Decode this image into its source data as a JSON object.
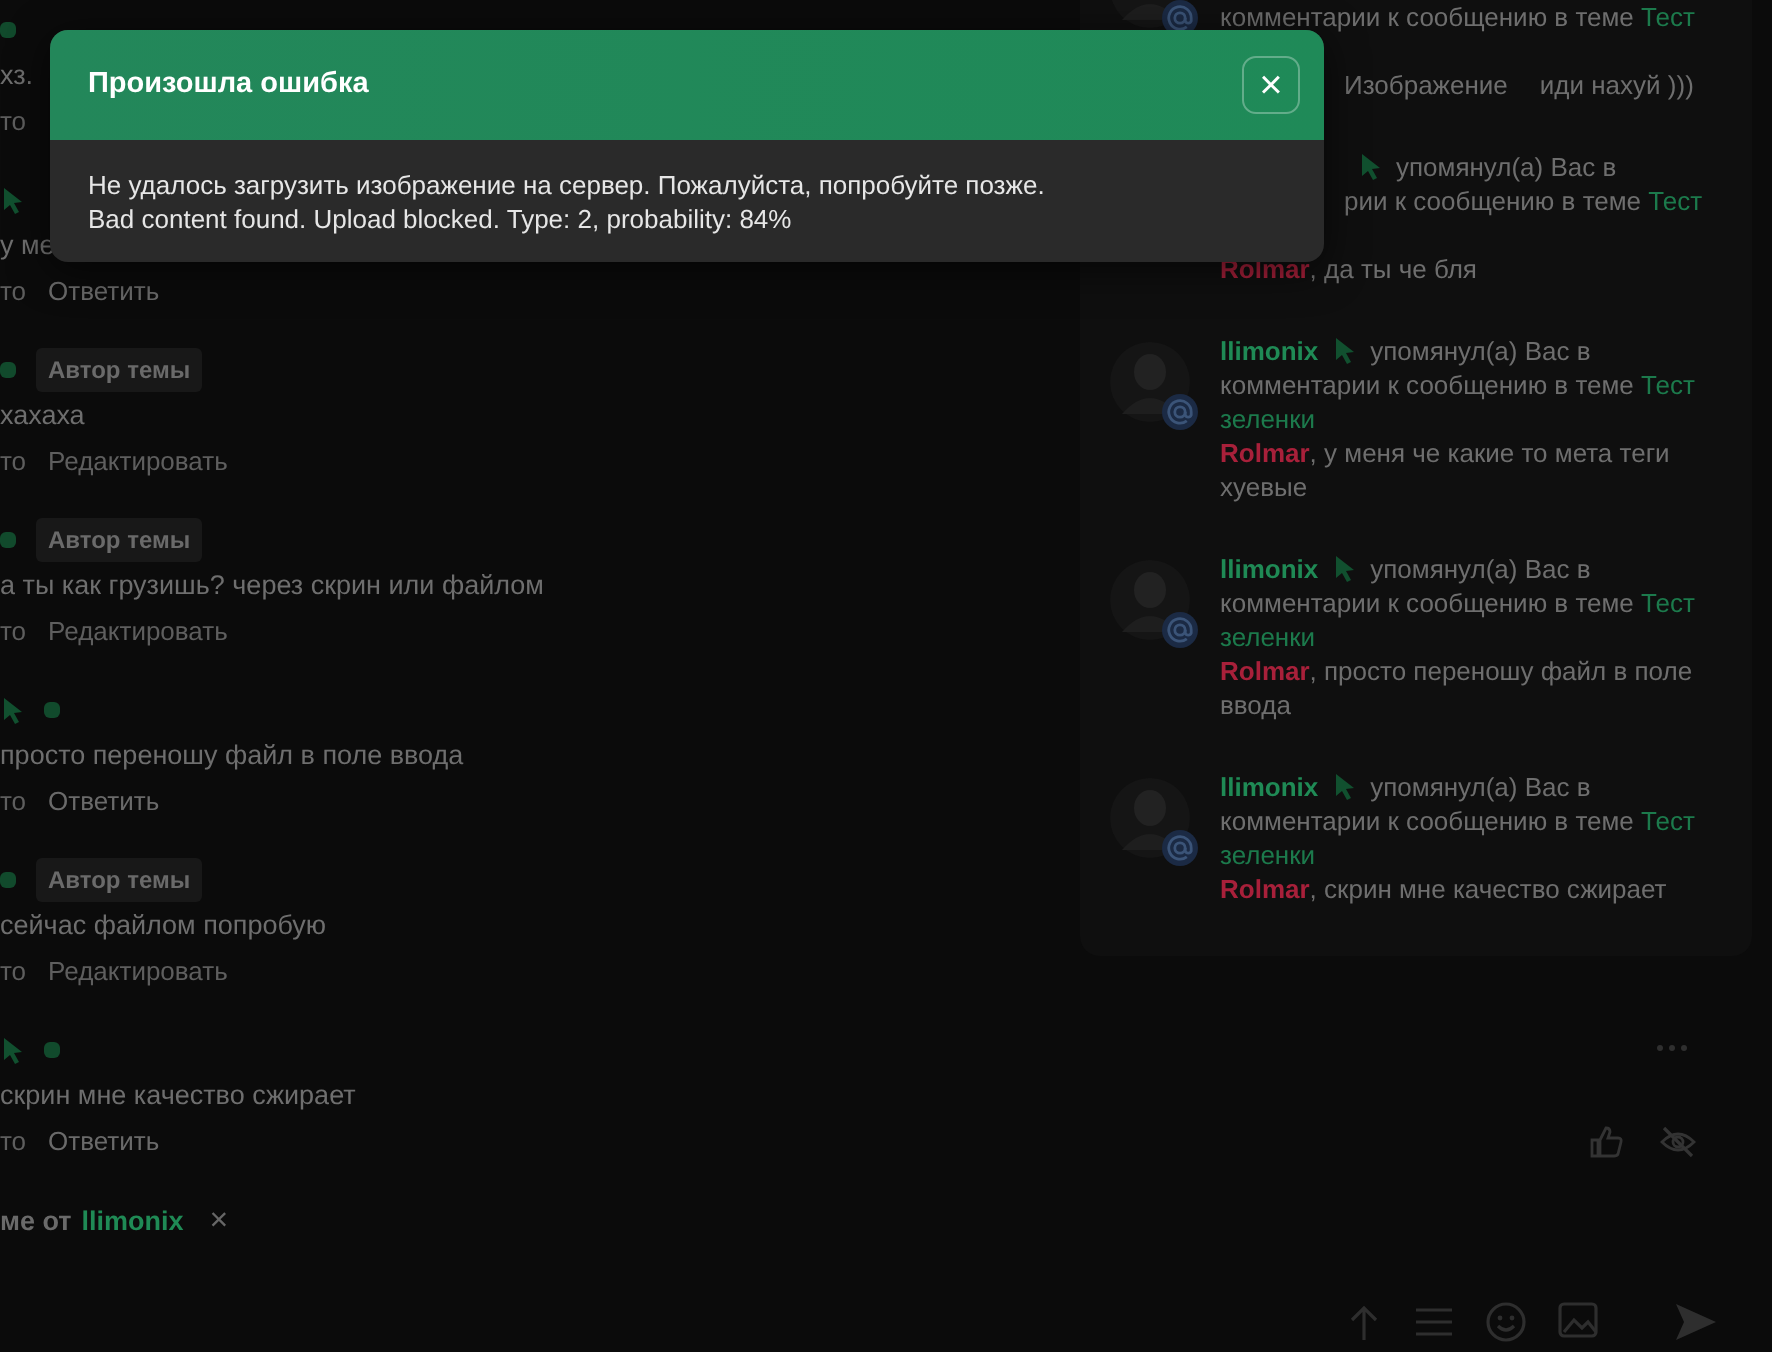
{
  "messages": [
    {
      "header": [
        {
          "kind": "dot"
        }
      ],
      "text": "хз.",
      "actions": [
        {
          "kind": "meta",
          "text": "то"
        }
      ]
    },
    {
      "header": [
        {
          "kind": "cursor"
        }
      ],
      "text": "у ме",
      "actions": [
        {
          "kind": "meta",
          "text": "то"
        },
        {
          "kind": "reply",
          "text": "Ответить"
        }
      ]
    },
    {
      "header": [
        {
          "kind": "dot"
        },
        {
          "kind": "badge",
          "text": "Автор темы"
        }
      ],
      "text": "хахаха",
      "actions": [
        {
          "kind": "meta",
          "text": "то"
        },
        {
          "kind": "edit",
          "text": "Редактировать"
        }
      ]
    },
    {
      "header": [
        {
          "kind": "dot"
        },
        {
          "kind": "badge",
          "text": "Автор темы"
        }
      ],
      "text": "а ты как грузишь? через скрин или файлом",
      "actions": [
        {
          "kind": "meta",
          "text": "то"
        },
        {
          "kind": "edit",
          "text": "Редактировать"
        }
      ]
    },
    {
      "header": [
        {
          "kind": "cursor"
        },
        {
          "kind": "dot"
        }
      ],
      "text": "просто переношу файл в поле ввода",
      "actions": [
        {
          "kind": "meta",
          "text": "то"
        },
        {
          "kind": "reply",
          "text": "Ответить"
        }
      ]
    },
    {
      "header": [
        {
          "kind": "dot"
        },
        {
          "kind": "badge",
          "text": "Автор темы"
        }
      ],
      "text": "сейчас файлом попробую",
      "actions": [
        {
          "kind": "meta",
          "text": "то"
        },
        {
          "kind": "edit",
          "text": "Редактировать"
        }
      ]
    },
    {
      "header": [
        {
          "kind": "cursor"
        },
        {
          "kind": "dot"
        }
      ],
      "text": "скрин мне качество сжирает",
      "actions": [
        {
          "kind": "meta",
          "text": "то"
        },
        {
          "kind": "reply",
          "text": "Ответить"
        }
      ]
    }
  ],
  "reply_bar": {
    "prefix": "ме от",
    "user": "llimonix",
    "close": "×"
  },
  "notifications": [
    {
      "avatar": true,
      "cut_top": true,
      "lines": [
        {
          "kind": "full",
          "segments": [
            {
              "kind": "plain",
              "text": "комментарии к сообщению в теме "
            },
            {
              "kind": "link",
              "text": "Тест"
            }
          ]
        },
        {
          "kind": "covered"
        },
        {
          "kind": "clipped",
          "segments": [
            {
              "kind": "plain",
              "text": "Изображение"
            },
            {
              "kind": "plain",
              "text": "иди нахуй )))"
            }
          ]
        }
      ]
    },
    {
      "avatar": false,
      "lines": [
        {
          "kind": "clipped",
          "segments": [
            {
              "kind": "icon"
            },
            {
              "kind": "plain",
              "text": "упомянул(а) Вас в"
            }
          ]
        },
        {
          "kind": "clipped",
          "segments": [
            {
              "kind": "plain",
              "text": "рии к сообщению в теме "
            },
            {
              "kind": "link",
              "text": "Тест"
            }
          ]
        },
        {
          "kind": "covered"
        },
        {
          "kind": "full",
          "segments": [
            {
              "kind": "author",
              "text": "Rolmar"
            },
            {
              "kind": "plain",
              "text": ", да ты че бля"
            }
          ]
        }
      ]
    },
    {
      "avatar": true,
      "lines": [
        {
          "kind": "full",
          "segments": [
            {
              "kind": "user",
              "text": "llimonix"
            },
            {
              "kind": "icon"
            },
            {
              "kind": "plain",
              "text": "упомянул(а) Вас в"
            }
          ]
        },
        {
          "kind": "full",
          "segments": [
            {
              "kind": "plain",
              "text": "комментарии к сообщению в теме "
            },
            {
              "kind": "link",
              "text": "Тест"
            }
          ]
        },
        {
          "kind": "full",
          "segments": [
            {
              "kind": "link",
              "text": "зеленки"
            }
          ]
        },
        {
          "kind": "full",
          "segments": [
            {
              "kind": "author",
              "text": "Rolmar"
            },
            {
              "kind": "plain",
              "text": ", у меня че какие то мета теги"
            }
          ]
        },
        {
          "kind": "full",
          "segments": [
            {
              "kind": "plain",
              "text": "хуевые"
            }
          ]
        }
      ]
    },
    {
      "avatar": true,
      "lines": [
        {
          "kind": "full",
          "segments": [
            {
              "kind": "user",
              "text": "llimonix"
            },
            {
              "kind": "icon"
            },
            {
              "kind": "plain",
              "text": "упомянул(а) Вас в"
            }
          ]
        },
        {
          "kind": "full",
          "segments": [
            {
              "kind": "plain",
              "text": "комментарии к сообщению в теме "
            },
            {
              "kind": "link",
              "text": "Тест"
            }
          ]
        },
        {
          "kind": "full",
          "segments": [
            {
              "kind": "link",
              "text": "зеленки"
            }
          ]
        },
        {
          "kind": "full",
          "segments": [
            {
              "kind": "author",
              "text": "Rolmar"
            },
            {
              "kind": "plain",
              "text": ", просто переношу файл в поле"
            }
          ]
        },
        {
          "kind": "full",
          "segments": [
            {
              "kind": "plain",
              "text": "ввода"
            }
          ]
        }
      ]
    },
    {
      "avatar": true,
      "lines": [
        {
          "kind": "full",
          "segments": [
            {
              "kind": "user",
              "text": "llimonix"
            },
            {
              "kind": "icon"
            },
            {
              "kind": "plain",
              "text": "упомянул(а) Вас в"
            }
          ]
        },
        {
          "kind": "full",
          "segments": [
            {
              "kind": "plain",
              "text": "комментарии к сообщению в теме "
            },
            {
              "kind": "link",
              "text": "Тест"
            }
          ]
        },
        {
          "kind": "full",
          "segments": [
            {
              "kind": "link",
              "text": "зеленки"
            }
          ]
        },
        {
          "kind": "full",
          "segments": [
            {
              "kind": "author",
              "text": "Rolmar"
            },
            {
              "kind": "plain",
              "text": ", скрин мне качество сжирает"
            }
          ]
        }
      ]
    }
  ],
  "dialog": {
    "title": "Произошла ошибка",
    "close": "×",
    "lines": [
      "Не удалось загрузить изображение на сервер. Пожалуйста, попробуйте позже.",
      "Bad content found. Upload blocked. Type: 2, probability: 84%"
    ]
  }
}
